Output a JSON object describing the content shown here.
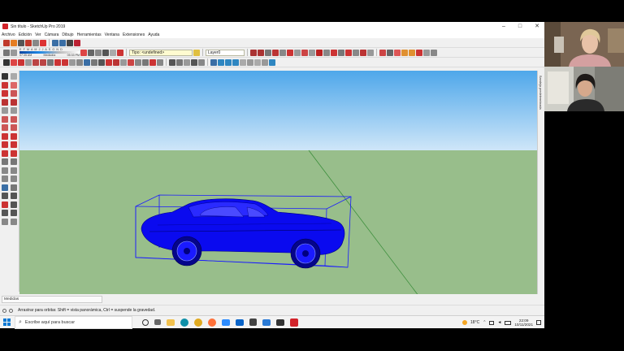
{
  "window": {
    "title": "Sin título - SketchUp Pro 2019",
    "controls": [
      "–",
      "□",
      "✕"
    ]
  },
  "menu": [
    "Archivo",
    "Edición",
    "Ver",
    "Cámara",
    "Dibujo",
    "Herramientas",
    "Ventana",
    "Extensiones",
    "Ayuda"
  ],
  "toolbar": {
    "shadow_months": "E F M A M J J A S O N D",
    "shadow_time_start": "07:35 AM",
    "shadow_time_mid": "Mediodía",
    "shadow_time_end": "05:33 PM",
    "type_field": "Tipo: <undefined>",
    "layer_field": "Layer0"
  },
  "tray": {
    "label": "Bandeja predeterminada"
  },
  "measurements": {
    "label": "Medidas"
  },
  "status": {
    "text": "Arrastrar para orbitar. Shift = vista panorámica, Ctrl = suspende la gravedad."
  },
  "taskbar": {
    "search_placeholder": "Escribe aquí para buscar",
    "weather": "18°C",
    "time": "22:09",
    "date": "10/11/2021"
  },
  "colors": {
    "accent_red": "#d2232a",
    "model_blue": "#0a0aef",
    "sky": "#6fb8ef",
    "ground": "#98be8b"
  }
}
